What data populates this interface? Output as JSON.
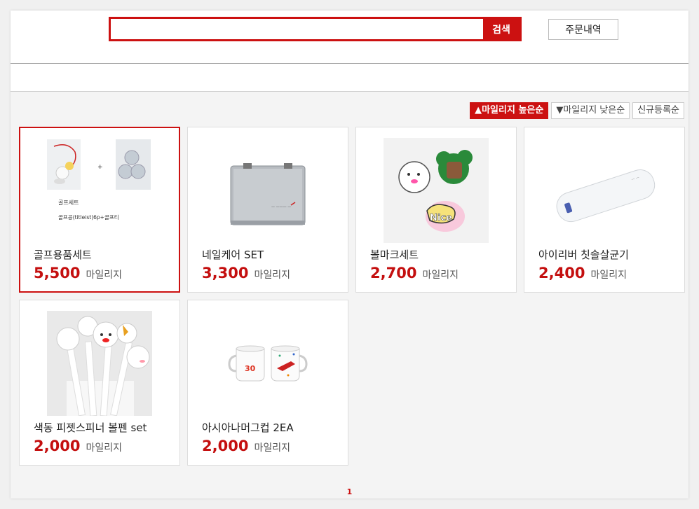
{
  "search": {
    "placeholder": "",
    "value": "",
    "button_label": "검색"
  },
  "header": {
    "order_history_label": "주문내역"
  },
  "sort": {
    "options": [
      {
        "label": "▲마일리지 높은순",
        "active": true
      },
      {
        "label": "▼마일리지 낮은순",
        "active": false
      },
      {
        "label": "신규등록순",
        "active": false
      }
    ]
  },
  "products": [
    {
      "name": "골프용품세트",
      "price": "5,500",
      "unit": "마일리지",
      "selected": true,
      "image": "golf-set-image",
      "image_text": [
        "골프세트",
        "골프공(titleist)6p+골프티"
      ]
    },
    {
      "name": "네일케어 SET",
      "price": "3,300",
      "unit": "마일리지",
      "selected": false,
      "image": "nail-care-case-image"
    },
    {
      "name": "볼마크세트",
      "price": "2,700",
      "unit": "마일리지",
      "selected": false,
      "image": "ball-marker-set-image",
      "image_text": [
        "Nice"
      ]
    },
    {
      "name": "아이리버 칫솔살균기",
      "price": "2,400",
      "unit": "마일리지",
      "selected": false,
      "image": "toothbrush-sterilizer-image"
    },
    {
      "name": "색동 피젯스피너 볼펜 set",
      "price": "2,000",
      "unit": "마일리지",
      "selected": false,
      "image": "fidget-pen-set-image"
    },
    {
      "name": "아시아나머그컵 2EA",
      "price": "2,000",
      "unit": "마일리지",
      "selected": false,
      "image": "asiana-mug-cups-image",
      "image_text": [
        "30"
      ]
    }
  ],
  "pagination": {
    "current": "1"
  },
  "colors": {
    "accent": "#cc1111",
    "price": "#c40f0f"
  }
}
